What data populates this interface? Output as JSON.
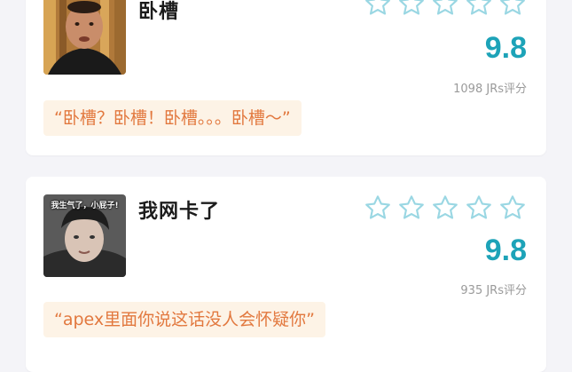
{
  "cards": [
    {
      "name": "卧槽",
      "score": "9.8",
      "votes": "1098 JRs评分",
      "quote": "“卧槽？卧槽！卧槽。。。卧槽～”",
      "stars_filled": 0,
      "stars_total": 5
    },
    {
      "name": "我网卡了",
      "score": "9.8",
      "votes": "935 JRs评分",
      "quote": "“apex里面你说这话没人会怀疑你”",
      "avatar_caption": "我生气了，小屁子!",
      "stars_filled": 0,
      "stars_total": 5
    }
  ],
  "colors": {
    "score": "#1da3b8",
    "star_outline": "#9ad7e3",
    "quote_text": "#e2783e",
    "quote_bg": "#fdf3e6"
  }
}
